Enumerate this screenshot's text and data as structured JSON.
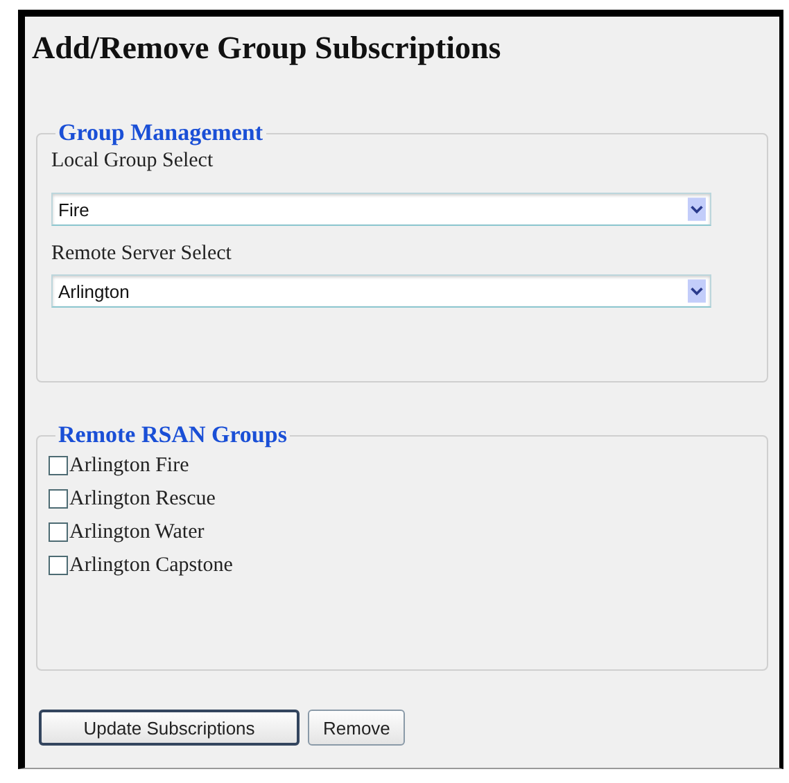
{
  "title": "Add/Remove Group Subscriptions",
  "group_management": {
    "legend": "Group Management",
    "fields": [
      {
        "label": "Local Group Select",
        "value": "Fire"
      },
      {
        "label": "Remote Server Select",
        "value": "Arlington"
      }
    ]
  },
  "remote_groups": {
    "legend": "Remote RSAN Groups",
    "items": [
      {
        "label": "Arlington Fire",
        "checked": false
      },
      {
        "label": "Arlington Rescue",
        "checked": false
      },
      {
        "label": "Arlington Water",
        "checked": false
      },
      {
        "label": "Arlington Capstone",
        "checked": false
      }
    ]
  },
  "buttons": [
    {
      "label": "Update Subscriptions",
      "focused": true
    },
    {
      "label": "Remove",
      "focused": false
    }
  ]
}
